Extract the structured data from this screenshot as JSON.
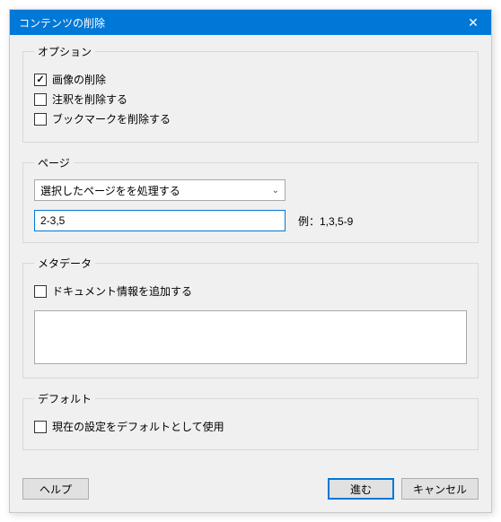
{
  "window": {
    "title": "コンテンツの削除"
  },
  "options": {
    "legend": "オプション",
    "delete_images": {
      "label": "画像の削除",
      "checked": true
    },
    "delete_annotations": {
      "label": "注釈を削除する",
      "checked": false
    },
    "delete_bookmarks": {
      "label": "ブックマークを削除する",
      "checked": false
    }
  },
  "pages": {
    "legend": "ページ",
    "select_value": "選択したページをを処理する",
    "range_value": "2-3,5",
    "example_label": "例：1,3,5-9"
  },
  "metadata": {
    "legend": "メタデータ",
    "add_docinfo": {
      "label": "ドキュメント情報を追加する",
      "checked": false
    },
    "text_value": ""
  },
  "defaults": {
    "legend": "デフォルト",
    "use_as_default": {
      "label": "現在の設定をデフォルトとして使用",
      "checked": false
    }
  },
  "buttons": {
    "help": "ヘルプ",
    "proceed": "進む",
    "cancel": "キャンセル"
  }
}
